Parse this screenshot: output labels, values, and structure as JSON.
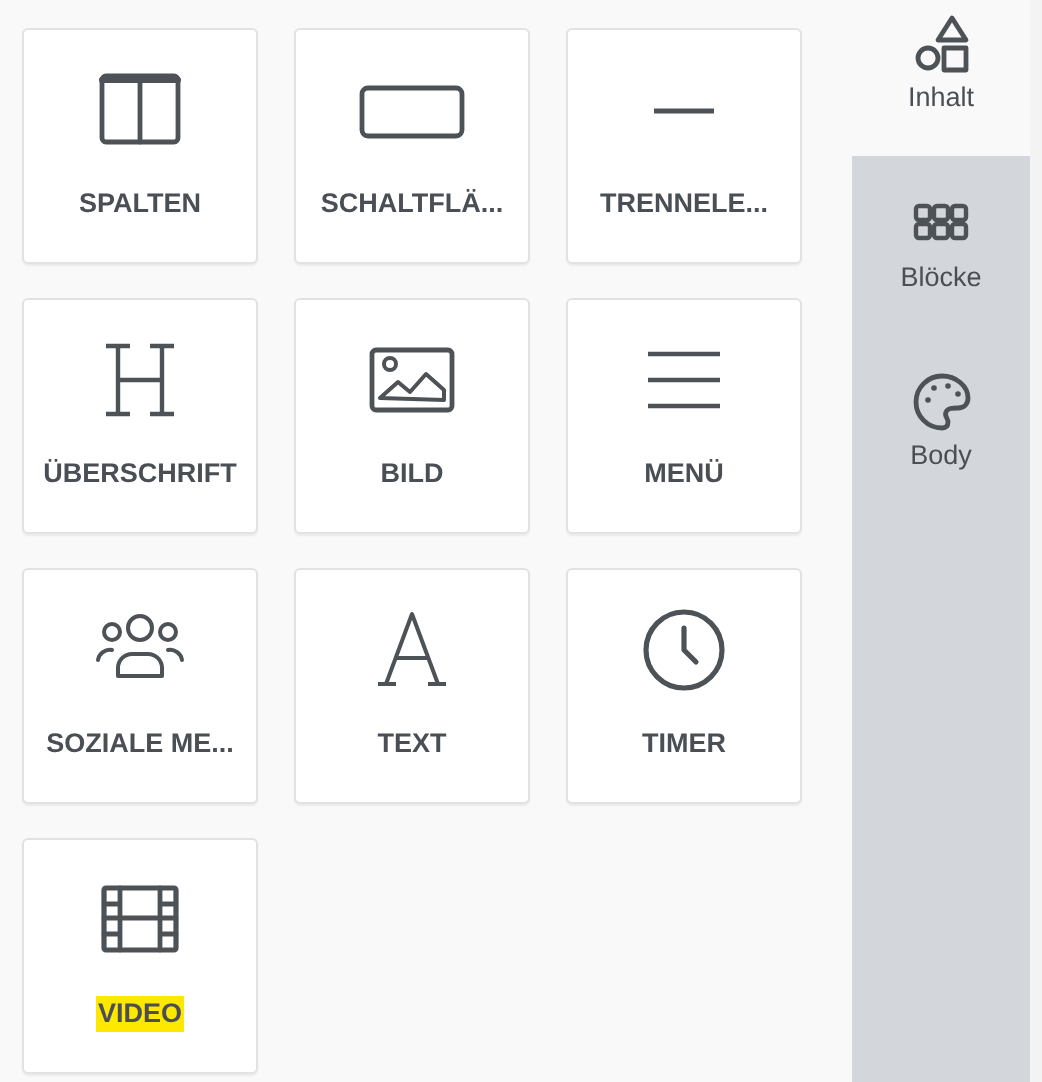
{
  "blocks": [
    {
      "label": "SPALTEN",
      "highlighted": false
    },
    {
      "label": "SCHALTFLÄ...",
      "highlighted": false
    },
    {
      "label": "TRENNELE...",
      "highlighted": false
    },
    {
      "label": "ÜBERSCHRIFT",
      "highlighted": false
    },
    {
      "label": "BILD",
      "highlighted": false
    },
    {
      "label": "MENÜ",
      "highlighted": false
    },
    {
      "label": "SOZIALE ME...",
      "highlighted": false
    },
    {
      "label": "TEXT",
      "highlighted": false
    },
    {
      "label": "TIMER",
      "highlighted": false
    },
    {
      "label": "VIDEO",
      "highlighted": true
    }
  ],
  "sidebar": {
    "tabs": [
      {
        "label": "Inhalt",
        "selected": true
      },
      {
        "label": "Blöcke",
        "selected": false
      },
      {
        "label": "Body",
        "selected": false
      }
    ]
  }
}
